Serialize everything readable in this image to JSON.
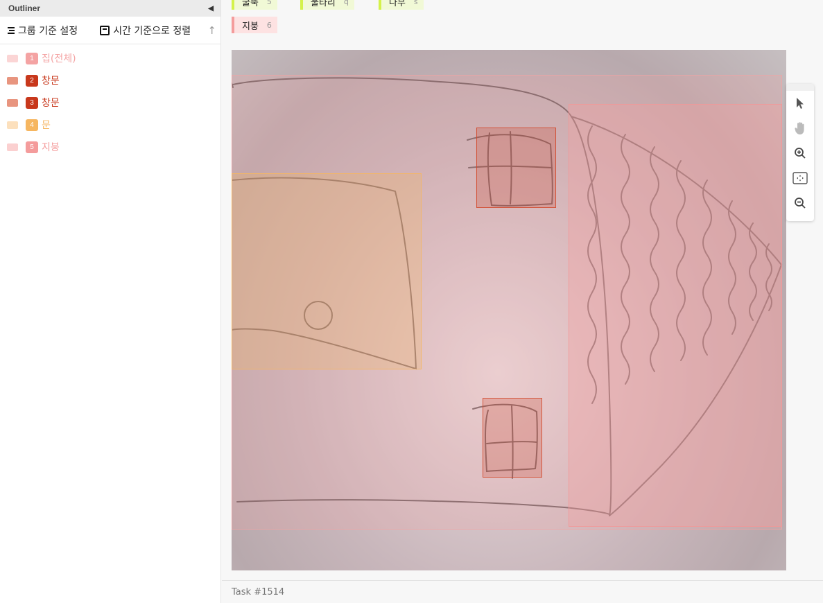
{
  "sidebar": {
    "title": "Outliner",
    "group_button": "그룹 기준 설정",
    "sort_button": "시간 기준으로 정렬",
    "items": [
      {
        "num": "1",
        "label": "집(전체)",
        "color": "#f4a3a3"
      },
      {
        "num": "2",
        "label": "창문",
        "color": "#c8381c"
      },
      {
        "num": "3",
        "label": "창문",
        "color": "#c8381c"
      },
      {
        "num": "4",
        "label": "문",
        "color": "#f6b660"
      },
      {
        "num": "5",
        "label": "지붕",
        "color": "#f49c9c"
      }
    ]
  },
  "labels": [
    {
      "name": "굴뚝",
      "hotkey": "5",
      "color": "#d4f24a"
    },
    {
      "name": "울타리",
      "hotkey": "q",
      "color": "#d4f24a"
    },
    {
      "name": "나무",
      "hotkey": "s",
      "color": "#d4f24a"
    },
    {
      "name": "지붕",
      "hotkey": "6",
      "color": "#f49c9c"
    }
  ],
  "tools": [
    "pointer-icon",
    "hand-icon",
    "zoom-in-icon",
    "fit-screen-icon",
    "zoom-out-icon"
  ],
  "footer": {
    "task": "Task #1514"
  }
}
